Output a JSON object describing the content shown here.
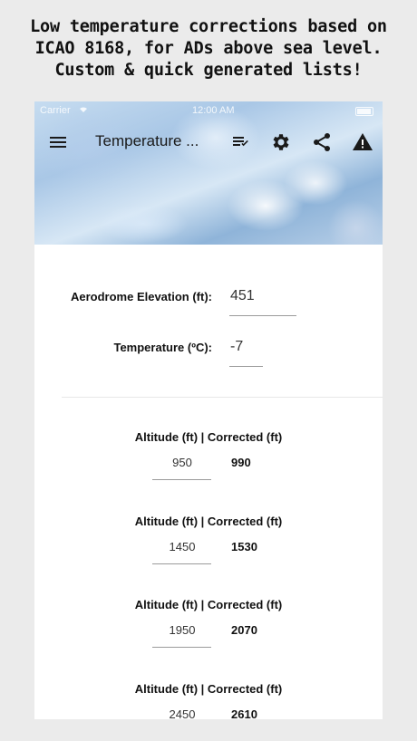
{
  "promo": {
    "line1": "Low temperature corrections based on",
    "line2": "ICAO 8168, for ADs above sea level.",
    "line3": "Custom & quick generated lists!"
  },
  "status_bar": {
    "carrier": "Carrier",
    "time": "12:00 AM"
  },
  "toolbar": {
    "title": "Temperature ...",
    "icons": [
      "menu-icon",
      "checklist-icon",
      "gear-icon",
      "share-icon",
      "warning-icon"
    ]
  },
  "inputs": {
    "elevation_label": "Aerodrome Elevation (ft):",
    "elevation_value": "451",
    "temperature_label": "Temperature (ºC):",
    "temperature_value": "-7"
  },
  "results": {
    "header": "Altitude (ft)   |  Corrected (ft)",
    "rows": [
      {
        "altitude": "950",
        "corrected": "990"
      },
      {
        "altitude": "1450",
        "corrected": "1530"
      },
      {
        "altitude": "1950",
        "corrected": "2070"
      },
      {
        "altitude": "2450",
        "corrected": "2610"
      }
    ]
  }
}
